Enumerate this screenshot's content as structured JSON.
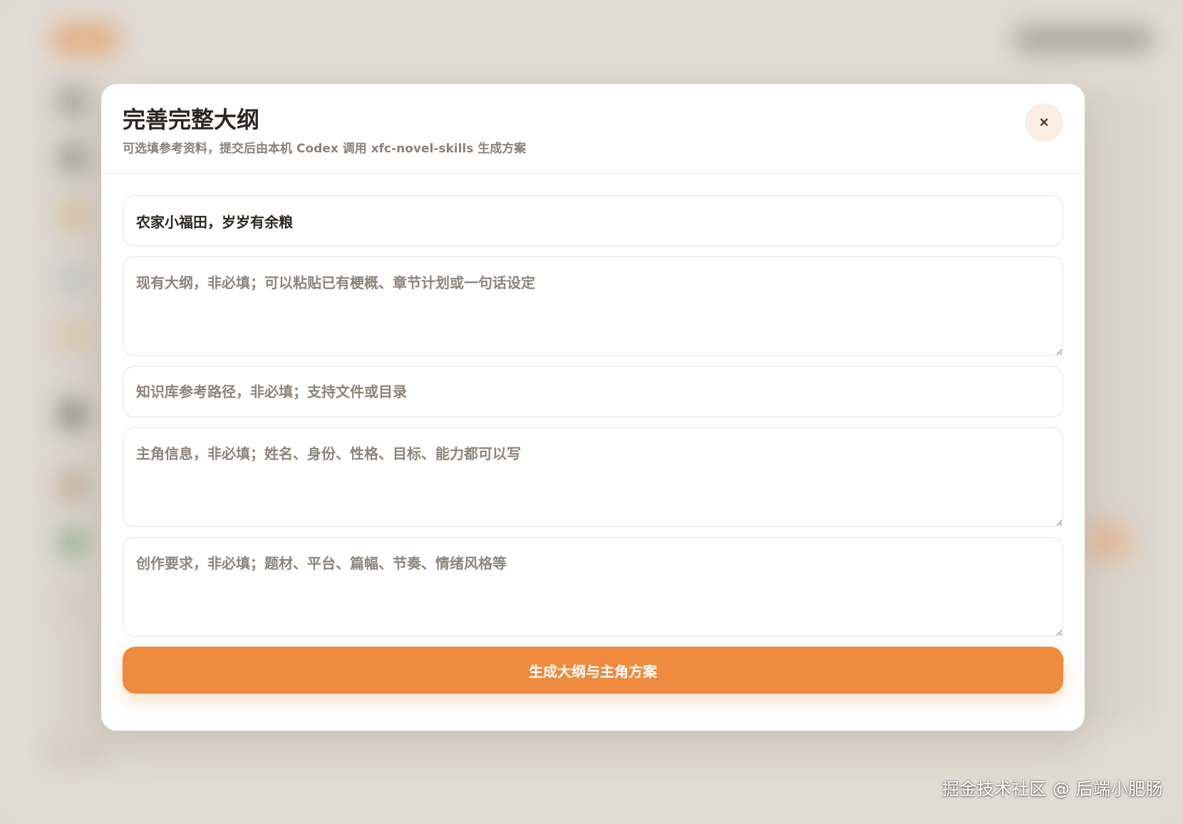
{
  "modal": {
    "title": "完善完整大纲",
    "subtitle": "可选填参考资料，提交后由本机 Codex 调用 xfc-novel-skills 生成方案",
    "close_label": "×"
  },
  "form": {
    "title_value": "农家小福田，岁岁有余粮",
    "outline_placeholder": "现有大纲，非必填；可以粘贴已有梗概、章节计划或一句话设定",
    "kb_path_placeholder": "知识库参考路径，非必填；支持文件或目录",
    "protagonist_placeholder": "主角信息，非必填；姓名、身份、性格、目标、能力都可以写",
    "requirements_placeholder": "创作要求，非必填；题材、平台、篇幅、节奏、情绪风格等",
    "submit_label": "生成大纲与主角方案"
  },
  "watermark": "掘金技术社区 @ 后端小肥肠",
  "colors": {
    "accent": "#ee8b3e",
    "close_bg": "#faeee2",
    "title_text": "#2b2620",
    "placeholder_text": "#8d847c"
  }
}
